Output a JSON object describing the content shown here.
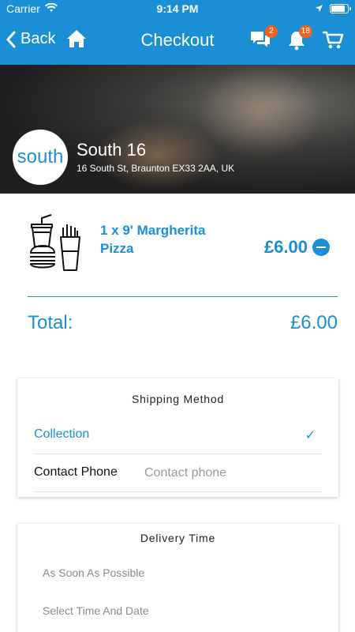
{
  "status_bar": {
    "carrier": "Carrier",
    "time": "9:14 PM",
    "battery_level": 0.92
  },
  "nav": {
    "back_label": "Back",
    "title": "Checkout",
    "messages_badge": "2",
    "notifications_badge": "18"
  },
  "restaurant": {
    "logo_text": "south",
    "name": "South 16",
    "address": "16 South St, Braunton EX33 2AA, UK"
  },
  "cart": {
    "item_name": "1 x 9' Margherita Pizza",
    "item_price": "£6.00",
    "total_label": "Total:",
    "total_value": "£6.00"
  },
  "shipping": {
    "title": "Shipping Method",
    "selected_method": "Collection",
    "phone_label": "Contact Phone",
    "phone_placeholder": "Contact phone",
    "phone_value": ""
  },
  "delivery": {
    "title": "Delivery Time",
    "option_asap": "As Soon As Possible",
    "option_schedule": "Select Time And Date"
  },
  "colors": {
    "accent": "#1a8fd6",
    "badge": "#f26322"
  }
}
